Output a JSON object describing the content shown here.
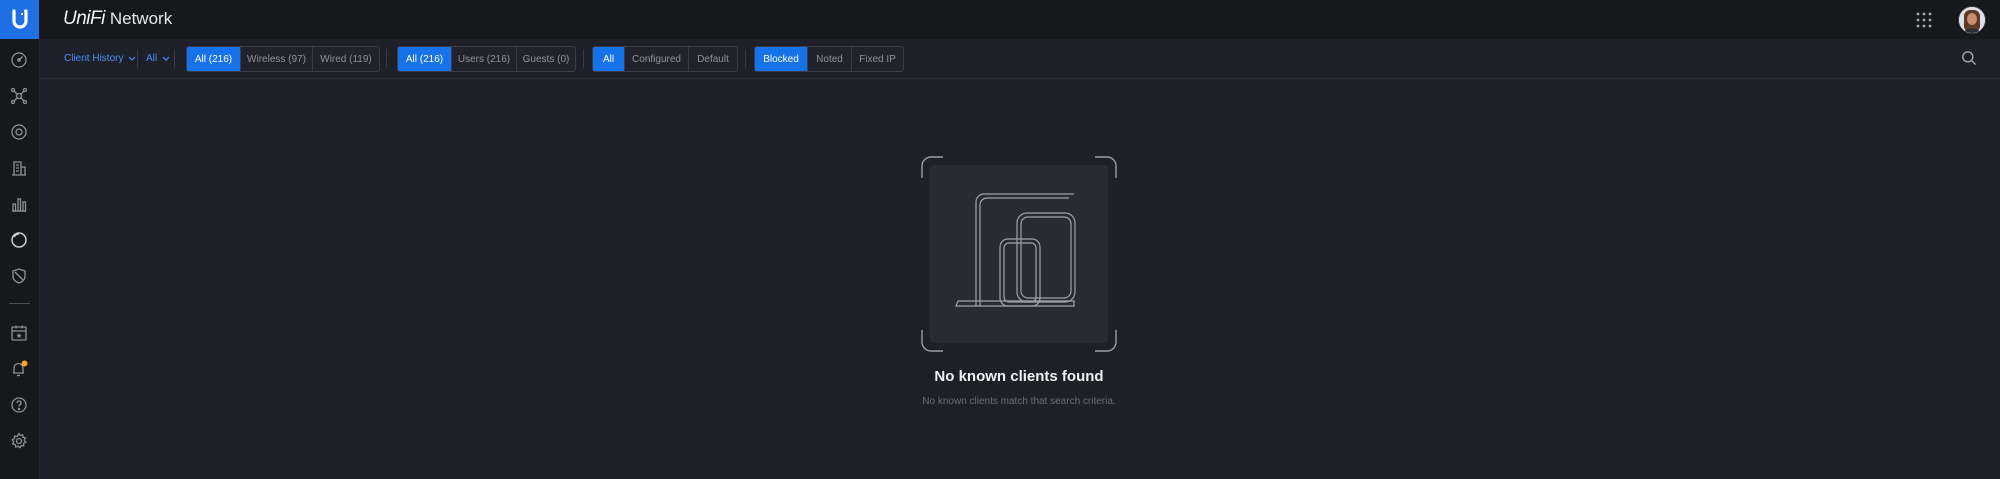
{
  "header": {
    "brand_unifi": "UniFi",
    "brand_network": "Network",
    "apps_icon": "grid-apps-icon",
    "avatar": "user-avatar"
  },
  "sidebar": {
    "items": [
      {
        "name": "dashboard",
        "icon": "speedometer-icon"
      },
      {
        "name": "topology",
        "icon": "topology-icon"
      },
      {
        "name": "devices",
        "icon": "target-icon"
      },
      {
        "name": "clients",
        "icon": "building-icon"
      },
      {
        "name": "statistics",
        "icon": "bar-chart-icon"
      },
      {
        "name": "insights",
        "icon": "pie-icon"
      },
      {
        "name": "traffic-security",
        "icon": "shield-icon"
      },
      {
        "name": "events",
        "icon": "calendar-star-icon"
      },
      {
        "name": "alerts",
        "icon": "bell-icon",
        "badge_color": "#f5a623"
      },
      {
        "name": "support",
        "icon": "help-circle-icon"
      },
      {
        "name": "settings",
        "icon": "gear-icon"
      }
    ]
  },
  "toolbar": {
    "history_label": "Client History",
    "scope_label": "All",
    "connection_filter": [
      {
        "label": "All (216)",
        "active": true
      },
      {
        "label": "Wireless (97)",
        "active": false
      },
      {
        "label": "Wired (119)",
        "active": false
      }
    ],
    "type_filter": [
      {
        "label": "All (216)",
        "active": true
      },
      {
        "label": "Users (216)",
        "active": false
      },
      {
        "label": "Guests (0)",
        "active": false
      }
    ],
    "config_filter": [
      {
        "label": "All",
        "active": true
      },
      {
        "label": "Configured",
        "active": false
      },
      {
        "label": "Default",
        "active": false
      }
    ],
    "status_filter": [
      {
        "label": "Blocked",
        "active": true
      },
      {
        "label": "Noted",
        "active": false
      },
      {
        "label": "Fixed IP",
        "active": false
      }
    ]
  },
  "empty_state": {
    "title": "No known clients found",
    "subtitle": "No known clients match that search criteria."
  },
  "colors": {
    "accent": "#1672e8",
    "link": "#4a8ef5",
    "background": "#1e2029",
    "chrome": "#17181d"
  }
}
